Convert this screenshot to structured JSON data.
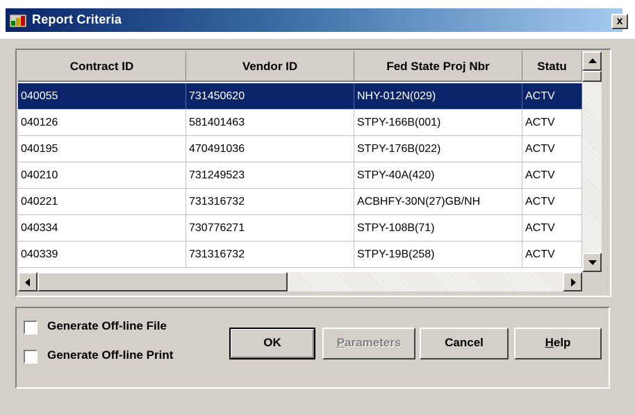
{
  "window": {
    "title": "Report Criteria",
    "close_label": "x"
  },
  "grid": {
    "columns": [
      "Contract ID",
      "Vendor ID",
      "Fed State Proj Nbr",
      "Statu"
    ],
    "rows": [
      [
        "040055",
        "731450620",
        "NHY-012N(029)",
        "ACTV"
      ],
      [
        "040126",
        "581401463",
        "STPY-166B(001)",
        "ACTV"
      ],
      [
        "040195",
        "470491036",
        "STPY-176B(022)",
        "ACTV"
      ],
      [
        "040210",
        "731249523",
        "STPY-40A(420)",
        "ACTV"
      ],
      [
        "040221",
        "731316732",
        "ACBHFY-30N(27)GB/NH",
        "ACTV"
      ],
      [
        "040334",
        "730776271",
        "STPY-108B(71)",
        "ACTV"
      ],
      [
        "040339",
        "731316732",
        "STPY-19B(258)",
        "ACTV"
      ]
    ],
    "selected_row": 0
  },
  "options": {
    "offline_file_label": "Generate Off-line File",
    "offline_print_label": "Generate Off-line Print"
  },
  "buttons": {
    "ok_label": "OK",
    "parameters_first": "P",
    "parameters_rest": "arameters",
    "cancel_label": "Cancel",
    "help_first": "H",
    "help_rest": "elp"
  },
  "colors": {
    "selection": "#0a246a",
    "face": "#d4d0c8"
  }
}
